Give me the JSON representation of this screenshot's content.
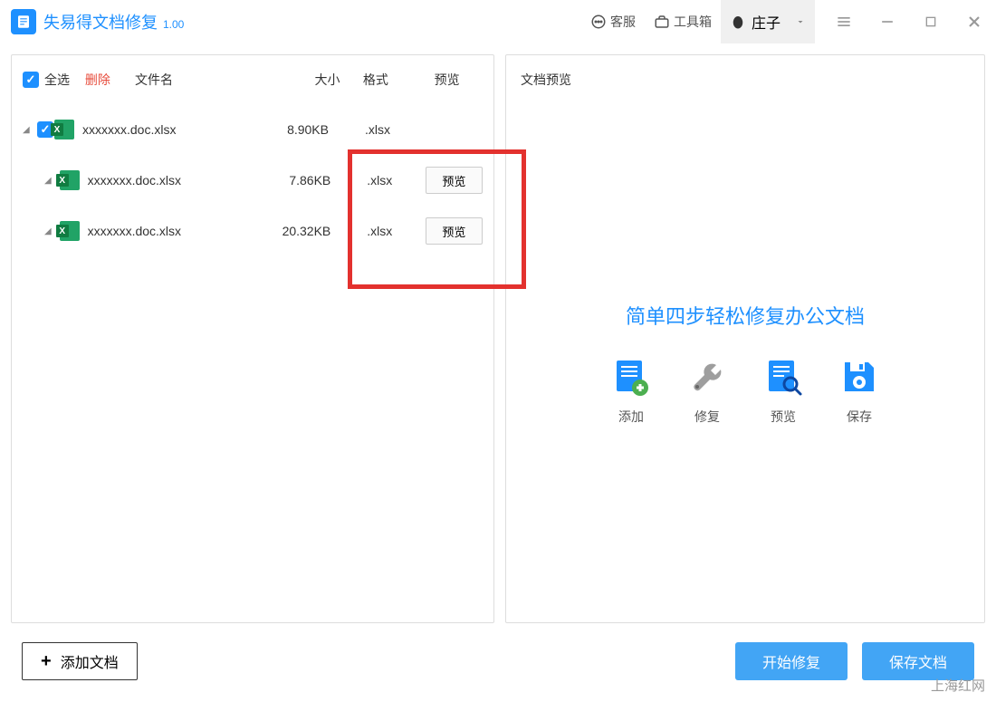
{
  "app": {
    "title": "失易得文档修复",
    "version": "1.00"
  },
  "titlebar": {
    "support": "客服",
    "toolbox": "工具箱",
    "user": "庄子"
  },
  "listHeader": {
    "selectAll": "全选",
    "delete": "删除",
    "fileName": "文件名",
    "size": "大小",
    "format": "格式",
    "preview": "预览"
  },
  "files": [
    {
      "name": "xxxxxxx.doc.xlsx",
      "size": "8.90KB",
      "format": ".xlsx",
      "checked": true,
      "indent": false,
      "showPreview": false
    },
    {
      "name": "xxxxxxx.doc.xlsx",
      "size": "7.86KB",
      "format": ".xlsx",
      "checked": false,
      "indent": true,
      "showPreview": true
    },
    {
      "name": "xxxxxxx.doc.xlsx",
      "size": "20.32KB",
      "format": ".xlsx",
      "checked": false,
      "indent": true,
      "showPreview": true
    }
  ],
  "previewBtnLabel": "预览",
  "preview": {
    "header": "文档预览",
    "title": "简单四步轻松修复办公文档",
    "steps": [
      {
        "label": "添加"
      },
      {
        "label": "修复"
      },
      {
        "label": "预览"
      },
      {
        "label": "保存"
      }
    ]
  },
  "bottom": {
    "addDoc": "添加文档",
    "startRepair": "开始修复",
    "saveDoc": "保存文档"
  },
  "watermark": "上海红网"
}
